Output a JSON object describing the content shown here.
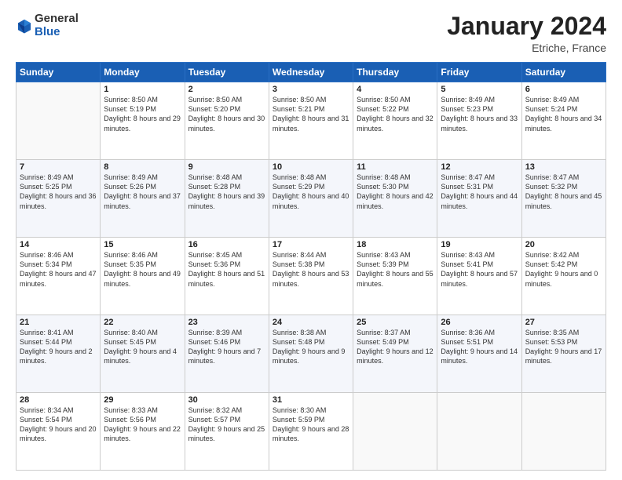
{
  "header": {
    "logo_general": "General",
    "logo_blue": "Blue",
    "month": "January 2024",
    "location": "Etriche, France"
  },
  "weekdays": [
    "Sunday",
    "Monday",
    "Tuesday",
    "Wednesday",
    "Thursday",
    "Friday",
    "Saturday"
  ],
  "weeks": [
    [
      {
        "day": "",
        "sunrise": "",
        "sunset": "",
        "daylight": ""
      },
      {
        "day": "1",
        "sunrise": "Sunrise: 8:50 AM",
        "sunset": "Sunset: 5:19 PM",
        "daylight": "Daylight: 8 hours and 29 minutes."
      },
      {
        "day": "2",
        "sunrise": "Sunrise: 8:50 AM",
        "sunset": "Sunset: 5:20 PM",
        "daylight": "Daylight: 8 hours and 30 minutes."
      },
      {
        "day": "3",
        "sunrise": "Sunrise: 8:50 AM",
        "sunset": "Sunset: 5:21 PM",
        "daylight": "Daylight: 8 hours and 31 minutes."
      },
      {
        "day": "4",
        "sunrise": "Sunrise: 8:50 AM",
        "sunset": "Sunset: 5:22 PM",
        "daylight": "Daylight: 8 hours and 32 minutes."
      },
      {
        "day": "5",
        "sunrise": "Sunrise: 8:49 AM",
        "sunset": "Sunset: 5:23 PM",
        "daylight": "Daylight: 8 hours and 33 minutes."
      },
      {
        "day": "6",
        "sunrise": "Sunrise: 8:49 AM",
        "sunset": "Sunset: 5:24 PM",
        "daylight": "Daylight: 8 hours and 34 minutes."
      }
    ],
    [
      {
        "day": "7",
        "sunrise": "Sunrise: 8:49 AM",
        "sunset": "Sunset: 5:25 PM",
        "daylight": "Daylight: 8 hours and 36 minutes."
      },
      {
        "day": "8",
        "sunrise": "Sunrise: 8:49 AM",
        "sunset": "Sunset: 5:26 PM",
        "daylight": "Daylight: 8 hours and 37 minutes."
      },
      {
        "day": "9",
        "sunrise": "Sunrise: 8:48 AM",
        "sunset": "Sunset: 5:28 PM",
        "daylight": "Daylight: 8 hours and 39 minutes."
      },
      {
        "day": "10",
        "sunrise": "Sunrise: 8:48 AM",
        "sunset": "Sunset: 5:29 PM",
        "daylight": "Daylight: 8 hours and 40 minutes."
      },
      {
        "day": "11",
        "sunrise": "Sunrise: 8:48 AM",
        "sunset": "Sunset: 5:30 PM",
        "daylight": "Daylight: 8 hours and 42 minutes."
      },
      {
        "day": "12",
        "sunrise": "Sunrise: 8:47 AM",
        "sunset": "Sunset: 5:31 PM",
        "daylight": "Daylight: 8 hours and 44 minutes."
      },
      {
        "day": "13",
        "sunrise": "Sunrise: 8:47 AM",
        "sunset": "Sunset: 5:32 PM",
        "daylight": "Daylight: 8 hours and 45 minutes."
      }
    ],
    [
      {
        "day": "14",
        "sunrise": "Sunrise: 8:46 AM",
        "sunset": "Sunset: 5:34 PM",
        "daylight": "Daylight: 8 hours and 47 minutes."
      },
      {
        "day": "15",
        "sunrise": "Sunrise: 8:46 AM",
        "sunset": "Sunset: 5:35 PM",
        "daylight": "Daylight: 8 hours and 49 minutes."
      },
      {
        "day": "16",
        "sunrise": "Sunrise: 8:45 AM",
        "sunset": "Sunset: 5:36 PM",
        "daylight": "Daylight: 8 hours and 51 minutes."
      },
      {
        "day": "17",
        "sunrise": "Sunrise: 8:44 AM",
        "sunset": "Sunset: 5:38 PM",
        "daylight": "Daylight: 8 hours and 53 minutes."
      },
      {
        "day": "18",
        "sunrise": "Sunrise: 8:43 AM",
        "sunset": "Sunset: 5:39 PM",
        "daylight": "Daylight: 8 hours and 55 minutes."
      },
      {
        "day": "19",
        "sunrise": "Sunrise: 8:43 AM",
        "sunset": "Sunset: 5:41 PM",
        "daylight": "Daylight: 8 hours and 57 minutes."
      },
      {
        "day": "20",
        "sunrise": "Sunrise: 8:42 AM",
        "sunset": "Sunset: 5:42 PM",
        "daylight": "Daylight: 9 hours and 0 minutes."
      }
    ],
    [
      {
        "day": "21",
        "sunrise": "Sunrise: 8:41 AM",
        "sunset": "Sunset: 5:44 PM",
        "daylight": "Daylight: 9 hours and 2 minutes."
      },
      {
        "day": "22",
        "sunrise": "Sunrise: 8:40 AM",
        "sunset": "Sunset: 5:45 PM",
        "daylight": "Daylight: 9 hours and 4 minutes."
      },
      {
        "day": "23",
        "sunrise": "Sunrise: 8:39 AM",
        "sunset": "Sunset: 5:46 PM",
        "daylight": "Daylight: 9 hours and 7 minutes."
      },
      {
        "day": "24",
        "sunrise": "Sunrise: 8:38 AM",
        "sunset": "Sunset: 5:48 PM",
        "daylight": "Daylight: 9 hours and 9 minutes."
      },
      {
        "day": "25",
        "sunrise": "Sunrise: 8:37 AM",
        "sunset": "Sunset: 5:49 PM",
        "daylight": "Daylight: 9 hours and 12 minutes."
      },
      {
        "day": "26",
        "sunrise": "Sunrise: 8:36 AM",
        "sunset": "Sunset: 5:51 PM",
        "daylight": "Daylight: 9 hours and 14 minutes."
      },
      {
        "day": "27",
        "sunrise": "Sunrise: 8:35 AM",
        "sunset": "Sunset: 5:53 PM",
        "daylight": "Daylight: 9 hours and 17 minutes."
      }
    ],
    [
      {
        "day": "28",
        "sunrise": "Sunrise: 8:34 AM",
        "sunset": "Sunset: 5:54 PM",
        "daylight": "Daylight: 9 hours and 20 minutes."
      },
      {
        "day": "29",
        "sunrise": "Sunrise: 8:33 AM",
        "sunset": "Sunset: 5:56 PM",
        "daylight": "Daylight: 9 hours and 22 minutes."
      },
      {
        "day": "30",
        "sunrise": "Sunrise: 8:32 AM",
        "sunset": "Sunset: 5:57 PM",
        "daylight": "Daylight: 9 hours and 25 minutes."
      },
      {
        "day": "31",
        "sunrise": "Sunrise: 8:30 AM",
        "sunset": "Sunset: 5:59 PM",
        "daylight": "Daylight: 9 hours and 28 minutes."
      },
      {
        "day": "",
        "sunrise": "",
        "sunset": "",
        "daylight": ""
      },
      {
        "day": "",
        "sunrise": "",
        "sunset": "",
        "daylight": ""
      },
      {
        "day": "",
        "sunrise": "",
        "sunset": "",
        "daylight": ""
      }
    ]
  ]
}
